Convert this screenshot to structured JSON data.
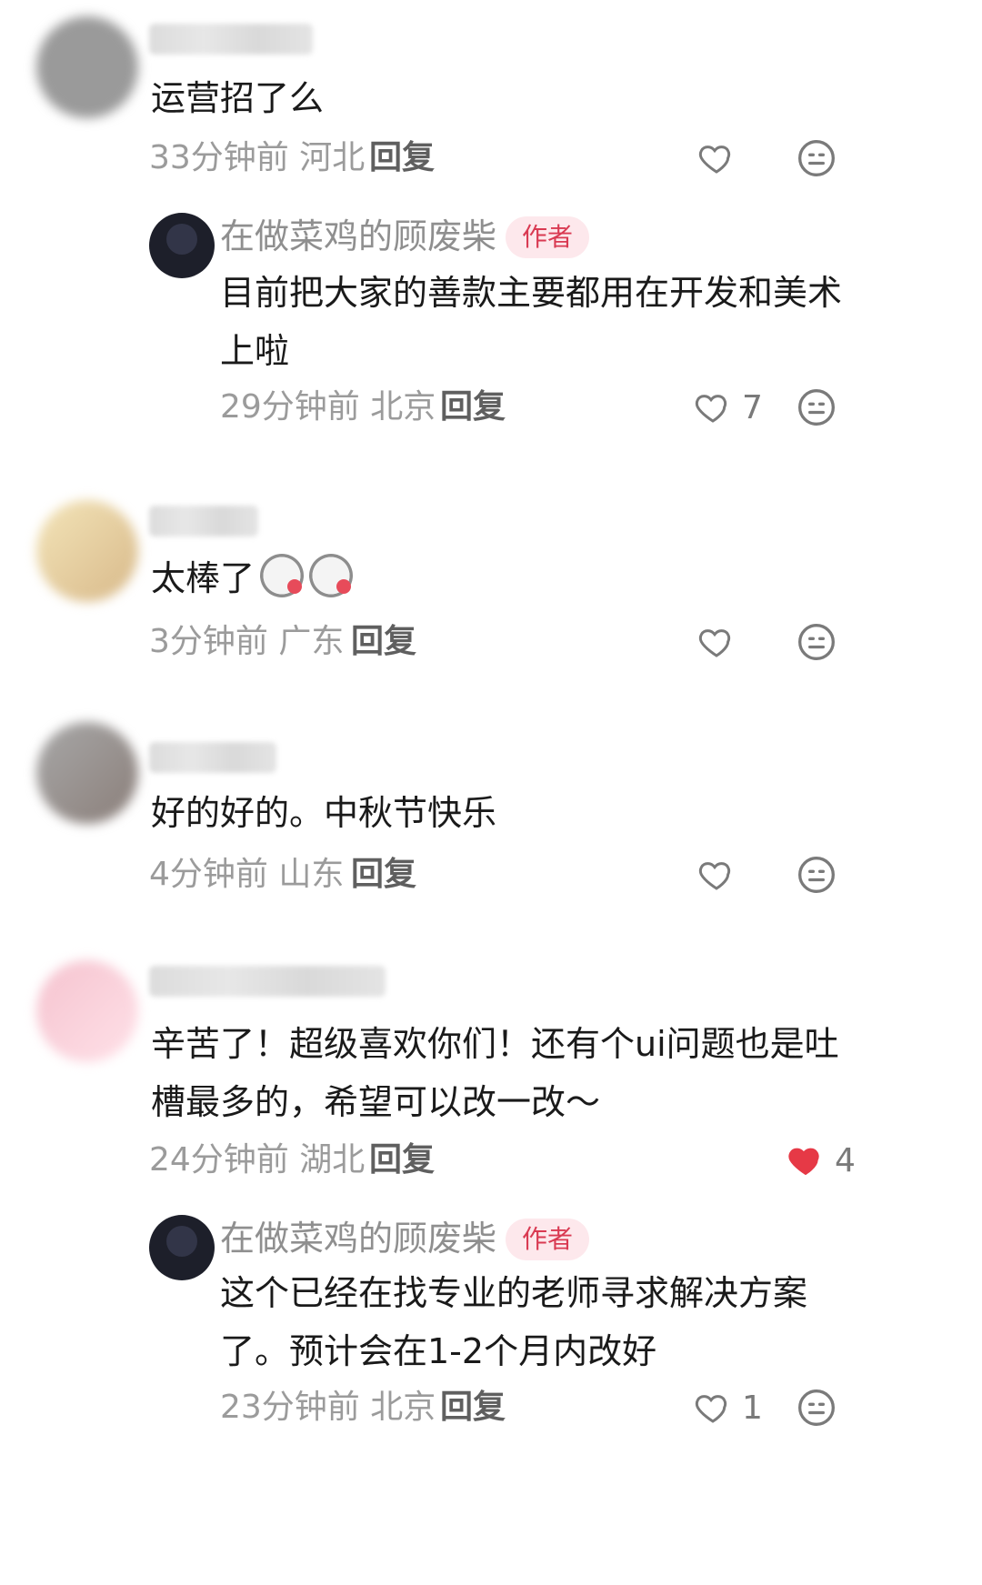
{
  "comments": [
    {
      "text": "运营招了么",
      "time": "33分钟前",
      "location": "河北",
      "reply_label": "回复",
      "likes": null,
      "liked": false,
      "replies": [
        {
          "author": "在做菜鸡的顾废柴",
          "badge": "作者",
          "text": "目前把大家的善款主要都用在开发和美术上啦",
          "time": "29分钟前",
          "location": "北京",
          "reply_label": "回复",
          "likes": "7",
          "liked": false
        }
      ]
    },
    {
      "text": "太棒了",
      "emoji": [
        "dog-heart-emoji",
        "dog-heart-emoji"
      ],
      "time": "3分钟前",
      "location": "广东",
      "reply_label": "回复",
      "likes": null,
      "liked": false
    },
    {
      "text": "好的好的。中秋节快乐",
      "time": "4分钟前",
      "location": "山东",
      "reply_label": "回复",
      "likes": null,
      "liked": false
    },
    {
      "text": "辛苦了！超级喜欢你们！还有个ui问题也是吐槽最多的，希望可以改一改～",
      "time": "24分钟前",
      "location": "湖北",
      "reply_label": "回复",
      "likes": "4",
      "liked": true,
      "replies": [
        {
          "author": "在做菜鸡的顾废柴",
          "badge": "作者",
          "text": "这个已经在找专业的老师寻求解决方案了。预计会在1-2个月内改好",
          "time": "23分钟前",
          "location": "北京",
          "reply_label": "回复",
          "likes": "1",
          "liked": false
        }
      ]
    }
  ],
  "colors": {
    "liked_heart": "#e63946",
    "badge_bg": "#fde8ec",
    "badge_text": "#d93a52"
  }
}
